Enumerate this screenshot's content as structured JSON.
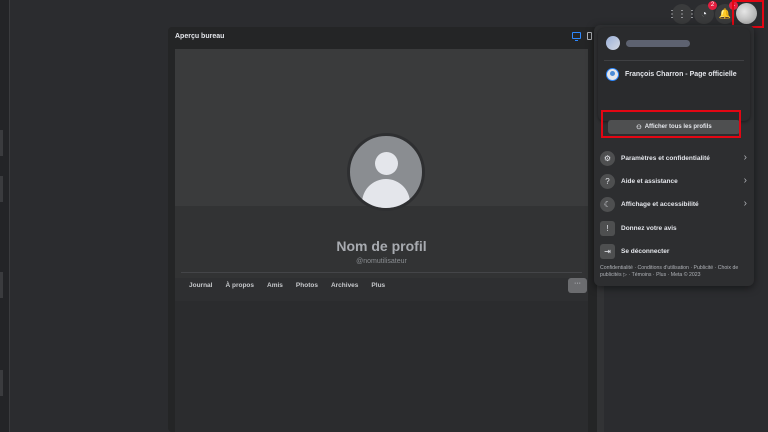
{
  "topbar": {
    "messenger_badge": "2",
    "notif_badge": "1"
  },
  "preview": {
    "title": "Aperçu bureau"
  },
  "profile": {
    "name": "Nom de profil",
    "handle": "@nomutilisateur",
    "tabs": [
      "Journal",
      "À propos",
      "Amis",
      "Photos",
      "Archives",
      "Plus"
    ],
    "more_label": "···"
  },
  "menu": {
    "page_name": "François Charron - Page officielle",
    "see_all_profiles": "Afficher tous les profils",
    "items": [
      {
        "label": "Paramètres et confidentialité",
        "icon": "⚙"
      },
      {
        "label": "Aide et assistance",
        "icon": "?"
      },
      {
        "label": "Affichage et accessibilité",
        "icon": "☾"
      },
      {
        "label": "Donnez votre avis",
        "icon": "!"
      },
      {
        "label": "Se déconnecter",
        "icon": "⇥"
      }
    ],
    "footer": "Confidentialité · Conditions d'utilisation · Publicité · Choix de publicités ▷ · Témoins · Plus · Meta © 2023"
  },
  "colors": {
    "highlight": "#e30613",
    "accent": "#2d88ff",
    "badge": "#e41e3f"
  }
}
